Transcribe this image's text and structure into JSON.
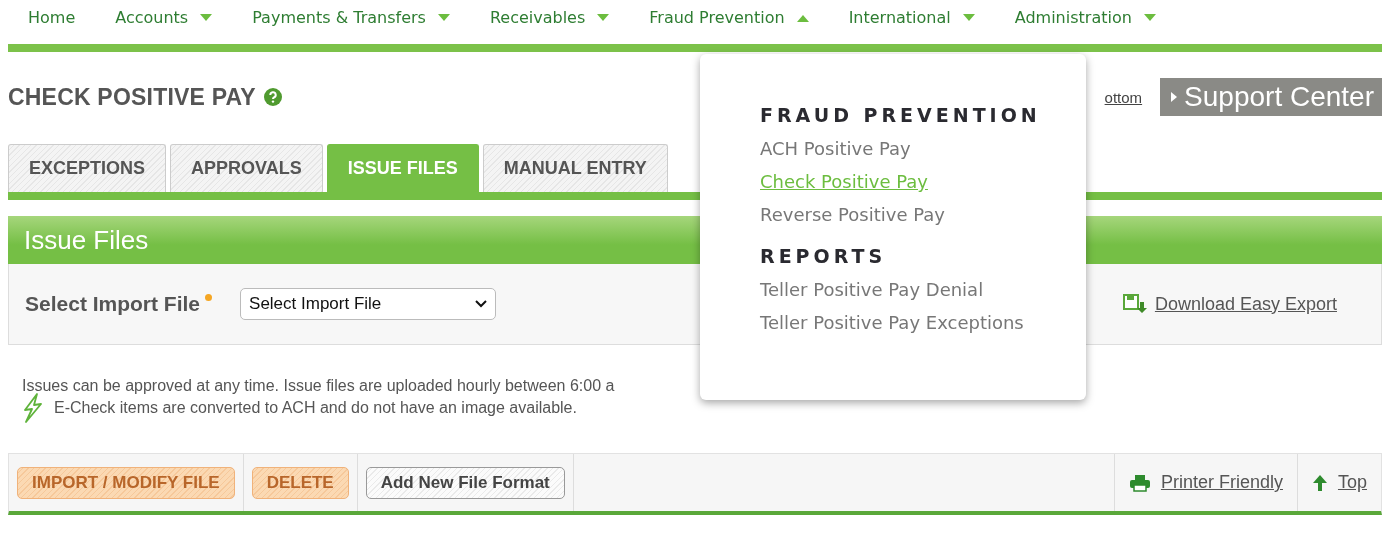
{
  "nav": [
    {
      "label": "Home",
      "kind": "link"
    },
    {
      "label": "Accounts",
      "kind": "menu",
      "expanded": false
    },
    {
      "label": "Payments & Transfers",
      "kind": "menu",
      "expanded": false
    },
    {
      "label": "Receivables",
      "kind": "menu",
      "expanded": false
    },
    {
      "label": "Fraud Prevention",
      "kind": "menu",
      "expanded": true
    },
    {
      "label": "International",
      "kind": "menu",
      "expanded": false
    },
    {
      "label": "Administration",
      "kind": "menu",
      "expanded": false
    }
  ],
  "page": {
    "title": "CHECK POSITIVE PAY",
    "jump_link": "ottom",
    "support": "Support Center"
  },
  "tabs": [
    {
      "label": "EXCEPTIONS",
      "selected": false
    },
    {
      "label": "APPROVALS",
      "selected": false
    },
    {
      "label": "ISSUE FILES",
      "selected": true
    },
    {
      "label": "MANUAL ENTRY",
      "selected": false
    }
  ],
  "panel": {
    "title": "Issue Files",
    "field_label": "Select Import File",
    "required": true,
    "select_value": "Select Import File",
    "download": "Download Easy Export"
  },
  "notes": [
    "Issues can be approved at any time. Issue files are uploaded hourly between 6:00 a",
    "E-Check items are converted to ACH and do not have an image available."
  ],
  "toolbar": {
    "buttons": [
      {
        "label": "IMPORT / MODIFY FILE",
        "disabled": true
      },
      {
        "label": "DELETE",
        "disabled": true
      },
      {
        "label": "Add New File Format",
        "disabled": false
      }
    ],
    "printer": "Printer Friendly",
    "top": "Top"
  },
  "menu": {
    "sections": [
      {
        "heading": "FRAUD PREVENTION",
        "items": [
          {
            "label": "ACH Positive Pay",
            "selected": false
          },
          {
            "label": "Check Positive Pay",
            "selected": true
          },
          {
            "label": "Reverse Positive Pay",
            "selected": false
          }
        ]
      },
      {
        "heading": "REPORTS",
        "items": [
          {
            "label": "Teller Positive Pay Denial",
            "selected": false
          },
          {
            "label": "Teller Positive Pay Exceptions",
            "selected": false
          }
        ]
      }
    ]
  }
}
